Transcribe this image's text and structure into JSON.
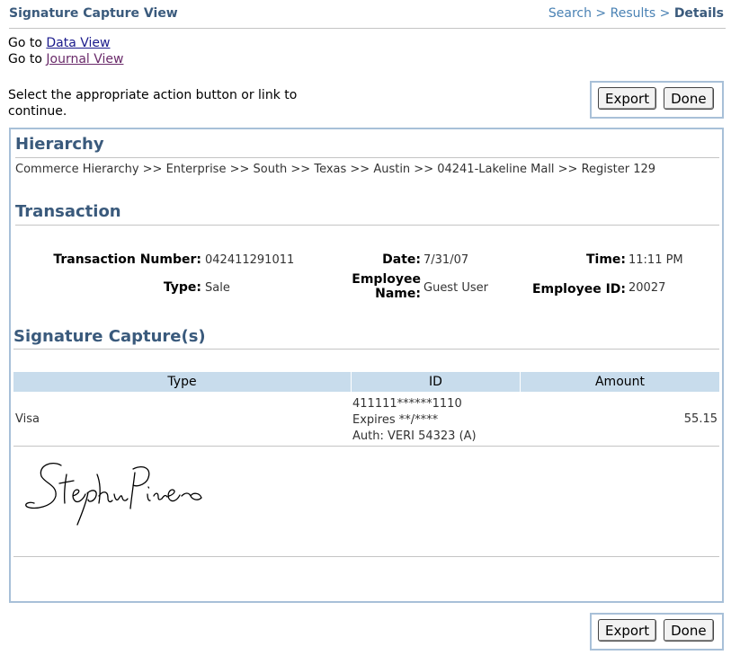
{
  "header": {
    "title": "Signature Capture View",
    "breadcrumb": {
      "search": "Search",
      "sep1": " > ",
      "results": "Results",
      "sep2": " > ",
      "current": "Details"
    }
  },
  "goto": {
    "prefix": "Go to ",
    "data_view": "Data View",
    "journal_view": "Journal View"
  },
  "instruction": "Select the appropriate action button or link to continue.",
  "buttons": {
    "export": "Export",
    "done": "Done"
  },
  "hierarchy": {
    "heading": "Hierarchy",
    "path": "Commerce Hierarchy >> Enterprise >> South >> Texas >> Austin >> 04241-Lakeline Mall >> Register 129"
  },
  "transaction": {
    "heading": "Transaction",
    "number_label": "Transaction Number:",
    "number": "042411291011",
    "date_label": "Date:",
    "date": "7/31/07",
    "time_label": "Time:",
    "time": "11:11 PM",
    "type_label": "Type:",
    "type": "Sale",
    "employee_name_label_1": "Employee",
    "employee_name_label_2": "Name:",
    "employee_name": "Guest User",
    "employee_id_label": "Employee ID:",
    "employee_id": "20027"
  },
  "captures": {
    "heading": "Signature Capture(s)",
    "columns": [
      "Type",
      "ID",
      "Amount"
    ],
    "rows": [
      {
        "type": "Visa",
        "id_line1": "411111******1110",
        "id_line2": "Expires **/****",
        "id_line3": "Auth: VERI 54323 (A)",
        "amount": "55.15"
      }
    ]
  }
}
